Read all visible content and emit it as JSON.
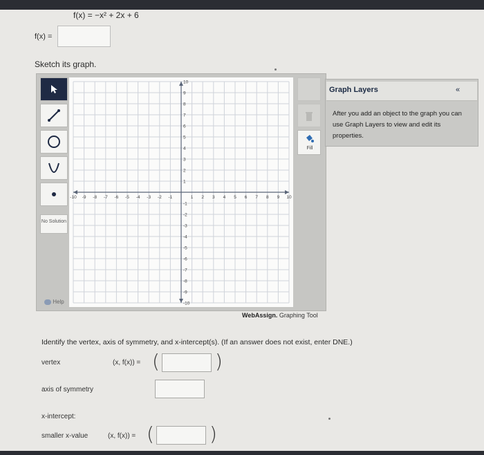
{
  "problem": {
    "function_display": "f(x) = −x² + 2x + 6",
    "fx_label": "f(x) =",
    "sketch_prompt": "Sketch its graph."
  },
  "graph_tool": {
    "tools": [
      "select-arrow-icon",
      "line-segment-icon",
      "circle-icon",
      "parabola-icon",
      "point-icon"
    ],
    "no_solution_label": "No Solution",
    "help_label": "Help",
    "fill_label": "Fill",
    "brand_main": "WebAssign.",
    "brand_sub": "Graphing Tool",
    "x_ticks": [
      "-10",
      "-9",
      "-8",
      "-7",
      "-6",
      "-5",
      "-4",
      "-3",
      "-2",
      "-1",
      "1",
      "2",
      "3",
      "4",
      "5",
      "6",
      "7",
      "8",
      "9",
      "10"
    ],
    "y_ticks": [
      "10",
      "9",
      "8",
      "7",
      "6",
      "5",
      "4",
      "3",
      "2",
      "1",
      "-1",
      "-2",
      "-3",
      "-4",
      "-5",
      "-6",
      "-7",
      "-8",
      "-9",
      "-10"
    ],
    "axis_range": {
      "xmin": -10,
      "xmax": 10,
      "ymin": -10,
      "ymax": 10
    },
    "grid": true
  },
  "layers": {
    "title": "Graph Layers",
    "collapse": "«",
    "body": "After you add an object to the graph you can use Graph Layers to view and edit its properties."
  },
  "questions": {
    "instruction": "Identify the vertex, axis of symmetry, and x-intercept(s). (If an answer does not exist, enter DNE.)",
    "vertex_label": "vertex",
    "pair_label": "(x, f(x)) =",
    "axis_label": "axis of symmetry",
    "xint_label": "x-intercept:",
    "smaller_label": "smaller x-value",
    "open_paren": "(",
    "close_paren": ")"
  },
  "colors": {
    "active_tool": "#1f2a44",
    "accent_red": "#c0392b",
    "tool_icon_blue": "#2f6db3"
  }
}
